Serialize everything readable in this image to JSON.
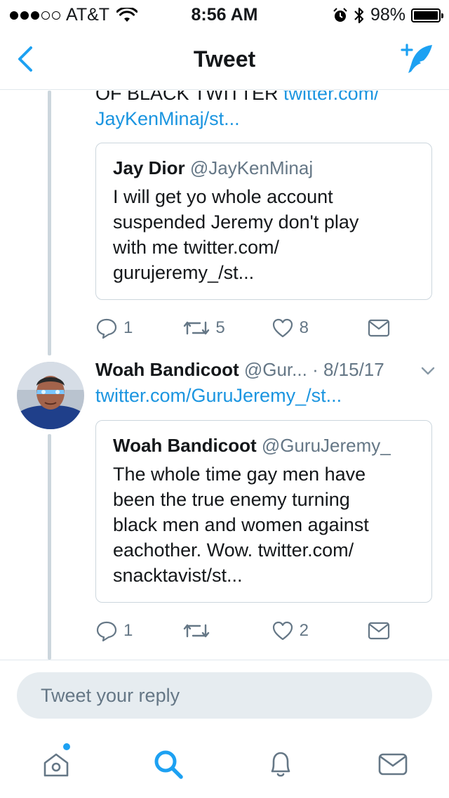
{
  "status_bar": {
    "carrier": "AT&T",
    "time": "8:56 AM",
    "battery": "98%",
    "battery_level": 0.98,
    "signal_bars_filled": 3,
    "signal_bars_total": 5
  },
  "nav": {
    "title": "Tweet",
    "accent_color": "#1da1f2"
  },
  "tweets": [
    {
      "text_lines": [
        "OF BLACK TWITTER"
      ],
      "link_inline": "twitter.com/",
      "link_line2": "JayKenMinaj/st...",
      "quote": {
        "name": "Jay Dior",
        "handle": "@JayKenMinaj",
        "body_lines": [
          "I will get yo whole account",
          "suspended Jeremy don't play",
          "with me twitter.com/",
          "gurujeremy_/st..."
        ]
      },
      "actions": {
        "reply_count": "1",
        "retweet_count": "5",
        "like_count": "8"
      }
    },
    {
      "name": "Woah Bandicoot",
      "handle": "@Gur...",
      "date": "· 8/15/17",
      "link": "twitter.com/GuruJeremy_/st...",
      "quote": {
        "name": "Woah Bandicoot",
        "handle": "@GuruJeremy_",
        "body_lines": [
          "The whole time gay men have",
          "been the true enemy turning",
          "black men and women against",
          "eachother. Wow. twitter.com/",
          "snacktavist/st..."
        ]
      },
      "actions": {
        "reply_count": "1",
        "retweet_count": "",
        "like_count": "2"
      }
    }
  ],
  "reply": {
    "placeholder": "Tweet your reply"
  },
  "tabs": [
    "home-icon",
    "search-icon",
    "notifications-icon",
    "messages-icon"
  ]
}
